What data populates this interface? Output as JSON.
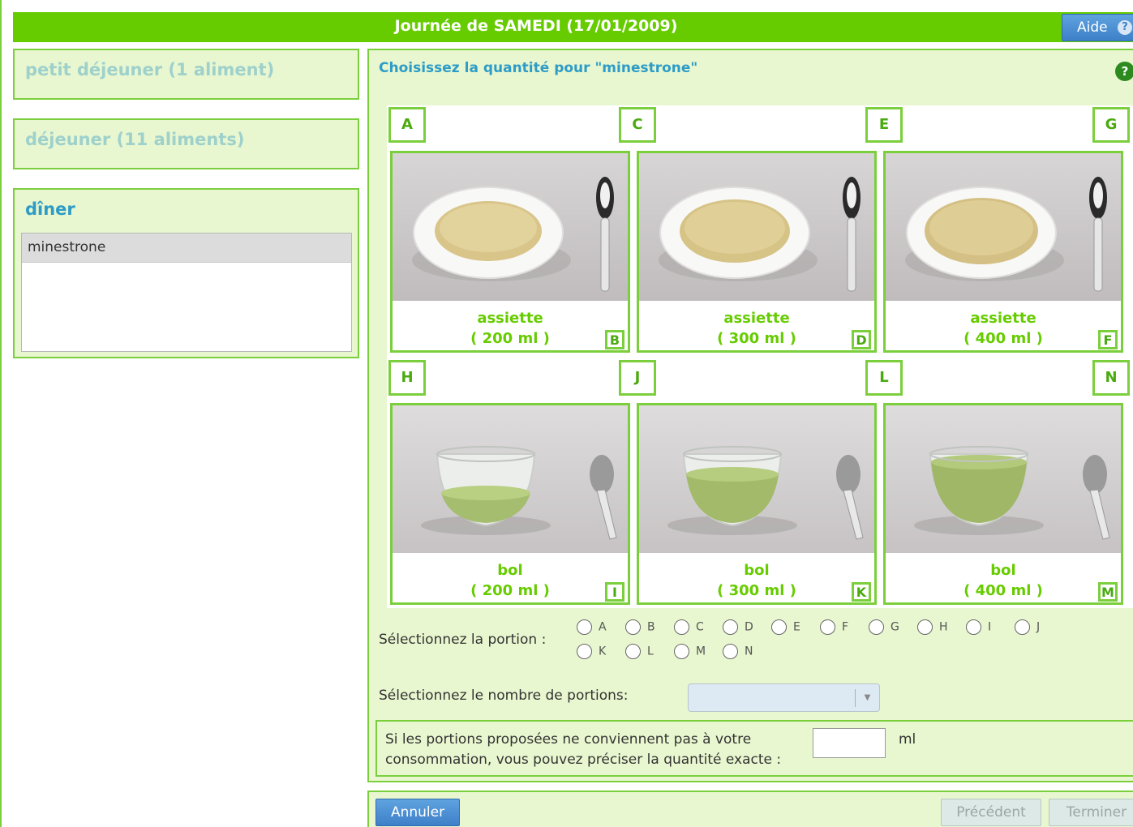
{
  "header": {
    "title": "Journée de SAMEDI (17/01/2009)",
    "help_label": "Aide",
    "help_icon": "question-icon"
  },
  "meals": {
    "breakfast": {
      "title": "petit déjeuner (1 aliment)"
    },
    "lunch": {
      "title": "déjeuner (11 aliments)"
    },
    "dinner": {
      "title": "dîner",
      "items": [
        "minestrone"
      ]
    }
  },
  "main": {
    "title": "Choisissez la quantité pour \"minestrone\"",
    "help_icon": "?",
    "portions": [
      {
        "tag": "A",
        "corner": "B",
        "line1": "assiette",
        "line2": "( 200 ml )",
        "kind": "plate"
      },
      {
        "tag": "C",
        "corner": "D",
        "line1": "assiette",
        "line2": "( 300 ml )",
        "kind": "plate"
      },
      {
        "tag": "E",
        "corner": "F",
        "line1": "assiette",
        "line2": "( 400 ml )",
        "kind": "plate"
      },
      {
        "tag": "G"
      },
      {
        "tag": "H",
        "corner": "I",
        "line1": "bol",
        "line2": "( 200 ml )",
        "kind": "bowl"
      },
      {
        "tag": "J",
        "corner": "K",
        "line1": "bol",
        "line2": "( 300 ml )",
        "kind": "bowl"
      },
      {
        "tag": "L",
        "corner": "M",
        "line1": "bol",
        "line2": "( 400 ml )",
        "kind": "bowl"
      },
      {
        "tag": "N"
      }
    ],
    "portion_label": "Sélectionnez la portion :",
    "portion_options": [
      "A",
      "B",
      "C",
      "D",
      "E",
      "F",
      "G",
      "H",
      "I",
      "J",
      "K",
      "L",
      "M",
      "N"
    ],
    "count_label": "Sélectionnez le nombre de portions:",
    "count_value": "",
    "exact_text": "Si les portions proposées ne conviennent pas à votre consommation, vous pouvez préciser la quantité exacte :",
    "exact_value": "",
    "exact_unit": "ml"
  },
  "footer": {
    "cancel": "Annuler",
    "previous": "Précédent",
    "finish": "Terminer"
  }
}
